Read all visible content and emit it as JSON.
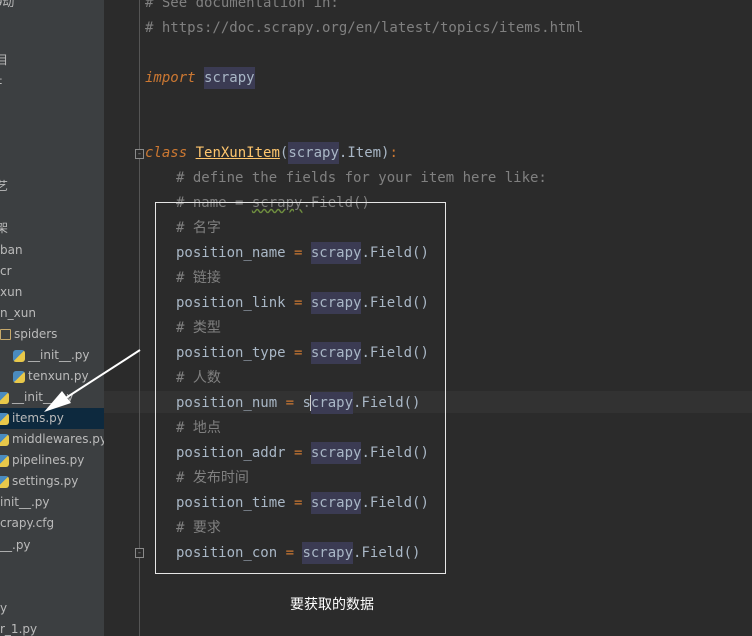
{
  "sidebar": {
    "items": [
      {
        "label": "∂动"
      },
      {
        "label": "目"
      },
      {
        "label": "‡"
      },
      {
        "label": "艺"
      },
      {
        "label": "架"
      },
      {
        "label": "ban"
      },
      {
        "label": "cr"
      },
      {
        "label": "xun"
      },
      {
        "label": "n_xun"
      },
      {
        "label": "spiders"
      },
      {
        "label": "__init__.py"
      },
      {
        "label": "tenxun.py"
      },
      {
        "label": "__init__.py"
      },
      {
        "label": "items.py"
      },
      {
        "label": "middlewares.py"
      },
      {
        "label": "pipelines.py"
      },
      {
        "label": "settings.py"
      },
      {
        "label": "init__.py"
      },
      {
        "label": "crapy.cfg"
      },
      {
        "label": "__.py"
      },
      {
        "label": "y"
      },
      {
        "label": "r_1.py"
      }
    ]
  },
  "editor": {
    "line_comment_see": "# See documentation in:",
    "line_comment_url": "# https://doc.scrapy.org/en/latest/topics/items.html",
    "kw_import": "import",
    "mod_scrapy": "scrapy",
    "kw_class": "class",
    "class_name": "TenXunItem",
    "paren_open": "(",
    "class_base_attr": ".Item)",
    "colon": ":",
    "comment_define": "# define the fields for your item here like:",
    "comment_name_prefix": "# name = ",
    "comment_name_suffix": ".Field()",
    "eq": " = ",
    "field_call": ".Field()",
    "field_call_caret": "crapy",
    "caret_s": "s",
    "fields": [
      {
        "comment": "# 名字",
        "name": "position_name"
      },
      {
        "comment": "# 链接",
        "name": "position_link"
      },
      {
        "comment": "# 类型",
        "name": "position_type"
      },
      {
        "comment": "# 人数",
        "name": "position_num"
      },
      {
        "comment": "# 地点",
        "name": "position_addr"
      },
      {
        "comment": "# 发布时间",
        "name": "position_time"
      },
      {
        "comment": "# 要求",
        "name": "position_con"
      }
    ]
  },
  "annotation": {
    "caption": "要获取的数据"
  },
  "colors": {
    "editor_bg": "#2b2b2b",
    "sidebar_bg": "#3c3f41",
    "comment": "#808080",
    "keyword": "#cc7832",
    "class_name": "#ffc66d",
    "text": "#a9b7c6",
    "highlight": "#3b3b53",
    "selected_row": "#0d293e"
  }
}
